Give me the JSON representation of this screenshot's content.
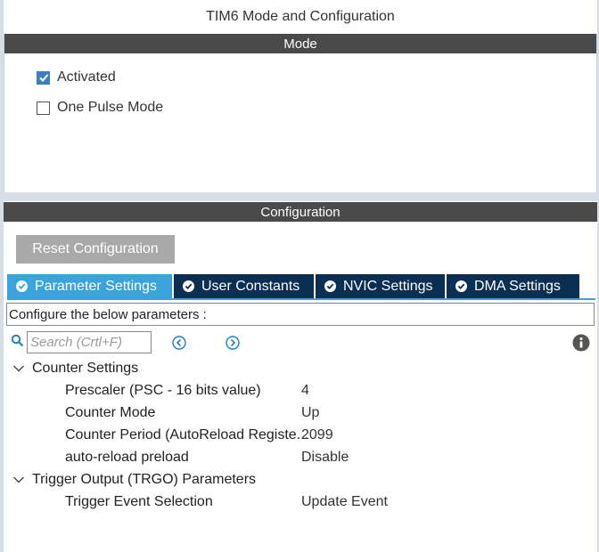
{
  "window": {
    "title": "TIM6 Mode and Configuration"
  },
  "mode": {
    "header": "Mode",
    "options": [
      {
        "label": "Activated",
        "checked": true
      },
      {
        "label": "One Pulse Mode",
        "checked": false
      }
    ]
  },
  "configuration": {
    "header": "Configuration",
    "reset_label": "Reset Configuration",
    "tabs": [
      {
        "label": "Parameter Settings",
        "active": true
      },
      {
        "label": "User Constants",
        "active": false
      },
      {
        "label": "NVIC Settings",
        "active": false
      },
      {
        "label": "DMA Settings",
        "active": false
      }
    ],
    "description": "Configure the below parameters :",
    "search_placeholder": "Search (Crtl+F)",
    "groups": [
      {
        "label": "Counter Settings",
        "params": [
          {
            "name": "Prescaler (PSC - 16 bits value)",
            "value": "4"
          },
          {
            "name": "Counter Mode",
            "value": "Up"
          },
          {
            "name": "Counter Period (AutoReload Registe...",
            "value": "2099"
          },
          {
            "name": "auto-reload preload",
            "value": "Disable"
          }
        ]
      },
      {
        "label": "Trigger Output (TRGO) Parameters",
        "params": [
          {
            "name": "Trigger Event Selection",
            "value": "Update Event"
          }
        ]
      }
    ]
  },
  "colors": {
    "header_bar": "#4a4a4a",
    "tab_active": "#3ba3dc",
    "tab_inactive": "#0b2f52",
    "checkbox_on": "#3a7fc1"
  }
}
